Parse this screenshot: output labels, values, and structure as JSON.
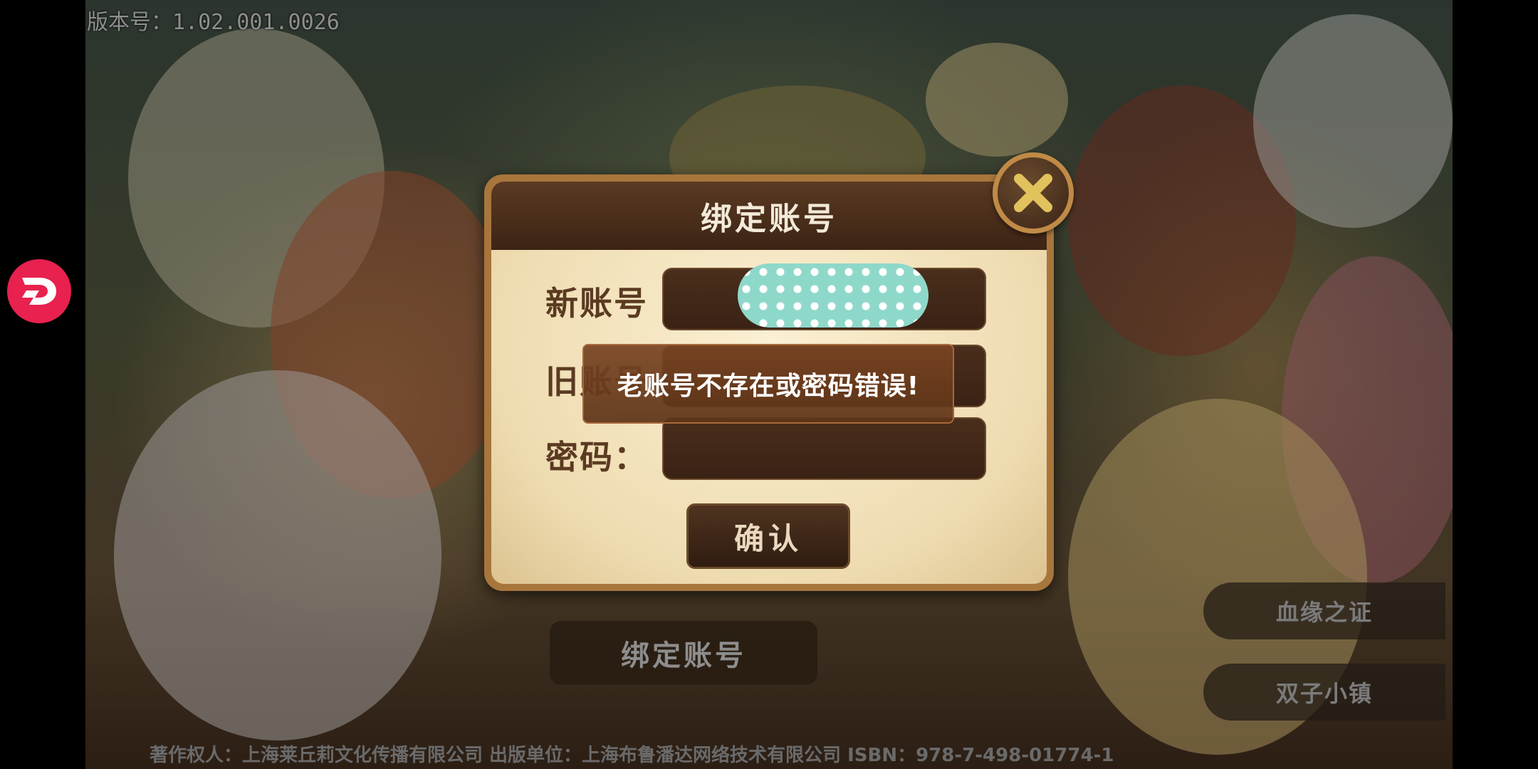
{
  "version_text": "版本号：1.02.001.0026",
  "dialog": {
    "title": "绑定账号",
    "fields": [
      {
        "label": "新账号",
        "value": ""
      },
      {
        "label": "旧账号",
        "value": ""
      },
      {
        "label": "密码：",
        "value": ""
      }
    ],
    "confirm_label": "确认",
    "close_icon": "close-x-icon"
  },
  "toast": {
    "message": "老账号不存在或密码错误!"
  },
  "background": {
    "bind_button_label": "绑定账号",
    "side_buttons": [
      "血缘之证",
      "双子小镇"
    ],
    "footer": "著作权人：上海莱丘莉文化传播有限公司  出版单位：上海布鲁潘达网络技术有限公司  ISBN：978-7-498-01774-1"
  },
  "floating_button_icon": "assistant-d-logo-icon",
  "colors": {
    "dialog_frame": "#a8763c",
    "dialog_header": "#3c2414",
    "panel": "#eedbb0",
    "toast_bg": "#784422",
    "float_button": "#e8214f",
    "redaction": "#8ed8ca"
  }
}
